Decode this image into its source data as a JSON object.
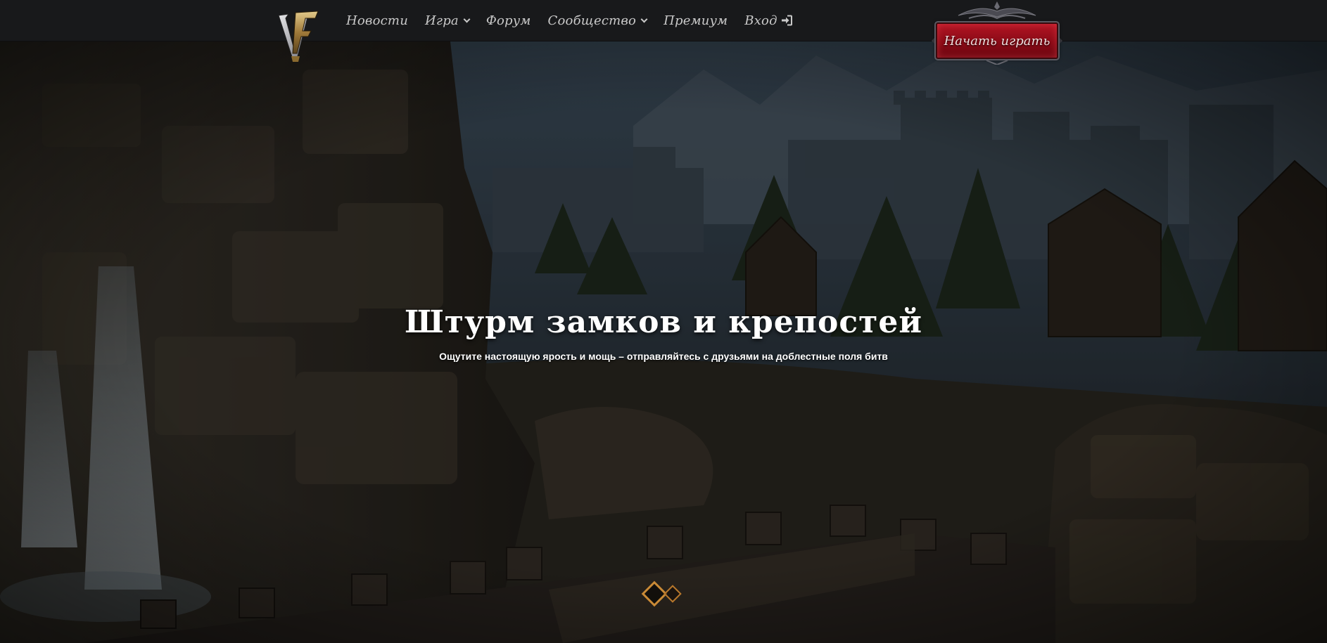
{
  "header": {
    "logo_icon": "game-monogram-logo",
    "nav": [
      {
        "label": "Новости",
        "has_dropdown": false
      },
      {
        "label": "Игра",
        "has_dropdown": true
      },
      {
        "label": "Форум",
        "has_dropdown": false
      },
      {
        "label": "Сообщество",
        "has_dropdown": true
      },
      {
        "label": "Премиум",
        "has_dropdown": false
      },
      {
        "label": "Вход",
        "has_dropdown": false,
        "icon": "sign-in-icon"
      }
    ],
    "play_button_label": "Начать играть"
  },
  "hero": {
    "title": "Штурм замков и крепостей",
    "subtitle": "Ощутите настоящую ярость и мощь – отправляйтесь с друзьями на доблестные поля битв",
    "slider": {
      "total": 2,
      "active_index": 0
    }
  },
  "colors": {
    "topbar": "#18191b",
    "nav_text": "#c9c9c9",
    "play_button": "#a01020",
    "slider_accent": "#c98a36"
  }
}
